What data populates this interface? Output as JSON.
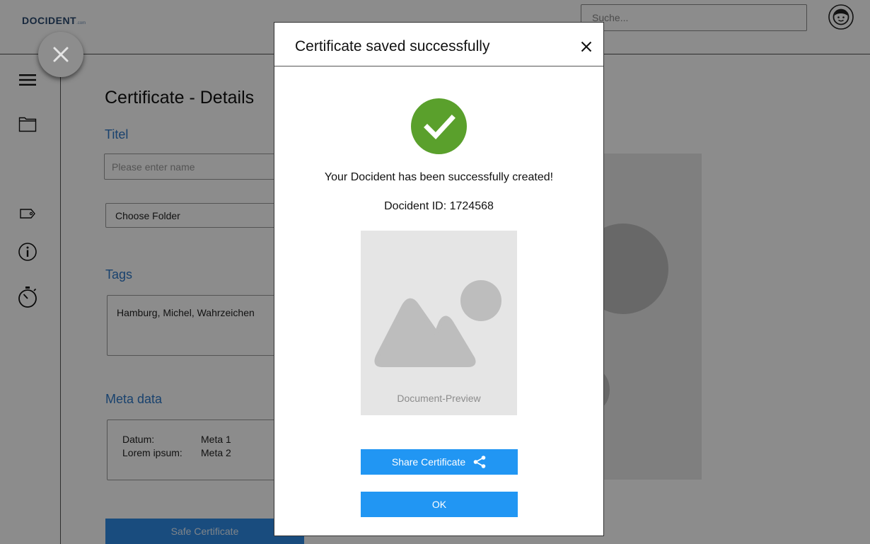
{
  "app": {
    "logo_main": "DOCIDENT",
    "logo_suffix": ".com",
    "search": {
      "placeholder": "Suche...",
      "value": ""
    }
  },
  "sidebar": {
    "icons": [
      "menu-icon",
      "folder-icon",
      "tag-icon",
      "info-icon",
      "stopwatch-icon"
    ]
  },
  "fab": {
    "icon": "close-icon"
  },
  "details": {
    "page_title": "Certificate - Details",
    "title_label": "Titel",
    "title_placeholder": "Please enter name",
    "folder_value": "Choose Folder",
    "tags_label": "Tags",
    "tags_value": "Hamburg, Michel, Wahrzeichen",
    "meta_label": "Meta data",
    "meta_rows": [
      {
        "key": "Datum:",
        "value": "Meta 1"
      },
      {
        "key": "Lorem ipsum:",
        "value": "Meta 2"
      }
    ],
    "save_button": "Safe Certificate"
  },
  "modal": {
    "title": "Certificate saved successfully",
    "close_icon": "close-icon",
    "success_icon": "checkmark-icon",
    "success_message": "Your Docident has been successfully created!",
    "docident_id": "Docident ID: 1724568",
    "preview_label": "Document-Preview",
    "share_button": "Share Certificate",
    "share_icon": "share-icon",
    "ok_button": "OK"
  },
  "colors": {
    "accent": "#2196f3",
    "success": "#5aa02c",
    "label_blue": "#2e78c8",
    "overlay": "rgba(0,0,0,0.45)"
  }
}
